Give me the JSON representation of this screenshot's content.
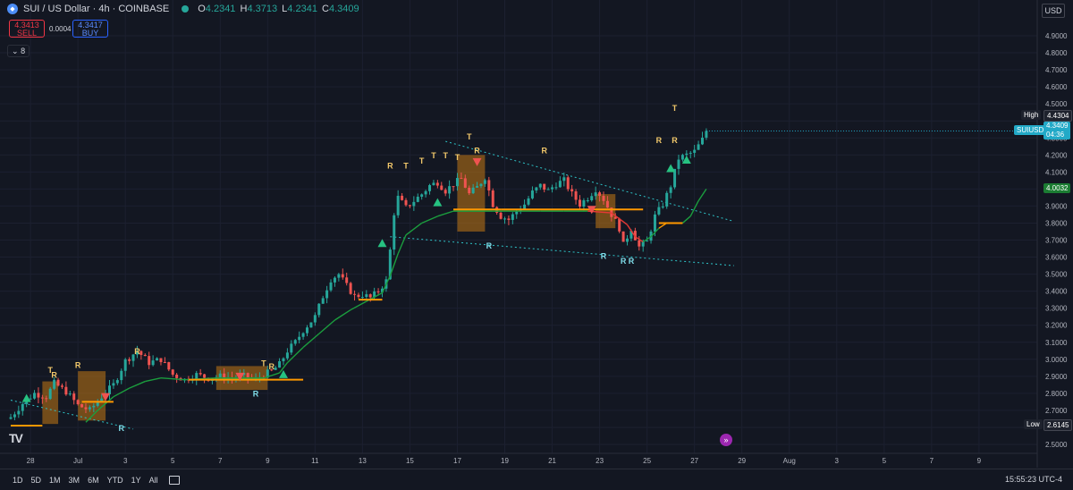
{
  "header": {
    "symbol_icon": "sui-coin-icon",
    "title": "SUI / US Dollar · 4h · COINBASE",
    "ohlc": [
      {
        "k": "O",
        "v": "4.2341"
      },
      {
        "k": "H",
        "v": "4.3713"
      },
      {
        "k": "L",
        "v": "4.2341"
      },
      {
        "k": "C",
        "v": "4.3409"
      }
    ],
    "sell_price": "4.3413",
    "sell_label": "SELL",
    "buy_price": "4.3417",
    "buy_label": "BUY",
    "spread": "0.0004",
    "indicator_count": "8"
  },
  "currency_button": "USD",
  "price_tags": {
    "high_label": "High",
    "high_value": "4.4304",
    "symbol_label": "SUIUSD",
    "last_value": "4.3409",
    "countdown": "04:36",
    "ma_value": "4.0032",
    "low_label": "Low",
    "low_value": "2.6145"
  },
  "toolbar": {
    "timeframes": [
      "1D",
      "5D",
      "1M",
      "3M",
      "6M",
      "YTD",
      "1Y",
      "All"
    ],
    "clock": "15:55:23 UTC-4"
  },
  "colors": {
    "up": "#26a69a",
    "down": "#ef5350",
    "ma": "#1b9e3e",
    "level": "#ff9800",
    "band": "#c27814",
    "trend": "#2ec4c8"
  },
  "chart_data": {
    "type": "candlestick",
    "symbol": "SUIUSD",
    "interval": "4h",
    "ylim": [
      2.5,
      4.9
    ],
    "y_ticks": [
      "4.9000",
      "4.8000",
      "4.7000",
      "4.6000",
      "4.5000",
      "4.4000",
      "4.3000",
      "4.2000",
      "4.1000",
      "4.0000",
      "3.9000",
      "3.8000",
      "3.7000",
      "3.6000",
      "3.5000",
      "3.4000",
      "3.3000",
      "3.2000",
      "3.1000",
      "3.0000",
      "2.9000",
      "2.8000",
      "2.7000",
      "2.6000",
      "2.5000"
    ],
    "y_tick_values": [
      4.9,
      4.8,
      4.7,
      4.6,
      4.5,
      4.4,
      4.3,
      4.2,
      4.1,
      4.0,
      3.9,
      3.8,
      3.7,
      3.6,
      3.5,
      3.4,
      3.3,
      3.2,
      3.1,
      3.0,
      2.9,
      2.8,
      2.7,
      2.6,
      2.5
    ],
    "x_ticks": [
      "28",
      "Jul",
      "3",
      "5",
      "7",
      "9",
      "11",
      "13",
      "15",
      "17",
      "19",
      "21",
      "23",
      "25",
      "27",
      "29",
      "Aug",
      "3",
      "5",
      "7",
      "9"
    ],
    "x_tick_bars": [
      5,
      17,
      29,
      41,
      53,
      65,
      77,
      89,
      101,
      113,
      125,
      137,
      149,
      161,
      173,
      185,
      197,
      209,
      221,
      233,
      245
    ],
    "close_path": [
      [
        0,
        2.66
      ],
      [
        3,
        2.74
      ],
      [
        6,
        2.8
      ],
      [
        9,
        2.78
      ],
      [
        11,
        2.86
      ],
      [
        14,
        2.81
      ],
      [
        17,
        2.73
      ],
      [
        20,
        2.7
      ],
      [
        23,
        2.78
      ],
      [
        26,
        2.85
      ],
      [
        29,
        2.99
      ],
      [
        32,
        3.05
      ],
      [
        35,
        2.98
      ],
      [
        38,
        3.0
      ],
      [
        41,
        2.91
      ],
      [
        44,
        2.88
      ],
      [
        47,
        2.91
      ],
      [
        50,
        2.89
      ],
      [
        53,
        2.9
      ],
      [
        56,
        2.89
      ],
      [
        59,
        2.9
      ],
      [
        62,
        2.88
      ],
      [
        64,
        2.91
      ],
      [
        66,
        2.93
      ],
      [
        68,
        2.97
      ],
      [
        70,
        3.05
      ],
      [
        72,
        3.1
      ],
      [
        74,
        3.17
      ],
      [
        77,
        3.25
      ],
      [
        79,
        3.37
      ],
      [
        81,
        3.47
      ],
      [
        83,
        3.5
      ],
      [
        85,
        3.43
      ],
      [
        87,
        3.37
      ],
      [
        89,
        3.38
      ],
      [
        91,
        3.36
      ],
      [
        93,
        3.4
      ],
      [
        95,
        3.46
      ],
      [
        96,
        3.64
      ],
      [
        97,
        3.86
      ],
      [
        98,
        3.95
      ],
      [
        100,
        3.89
      ],
      [
        102,
        3.93
      ],
      [
        104,
        3.97
      ],
      [
        106,
        4.02
      ],
      [
        108,
        4.04
      ],
      [
        110,
        3.99
      ],
      [
        112,
        4.03
      ],
      [
        114,
        4.06
      ],
      [
        116,
        3.97
      ],
      [
        118,
        4.01
      ],
      [
        120,
        4.07
      ],
      [
        122,
        3.91
      ],
      [
        124,
        3.84
      ],
      [
        126,
        3.82
      ],
      [
        128,
        3.87
      ],
      [
        130,
        3.91
      ],
      [
        132,
        3.98
      ],
      [
        134,
        4.02
      ],
      [
        136,
        3.99
      ],
      [
        138,
        4.03
      ],
      [
        140,
        4.05
      ],
      [
        142,
        3.97
      ],
      [
        144,
        3.91
      ],
      [
        146,
        3.95
      ],
      [
        148,
        4.0
      ],
      [
        150,
        3.94
      ],
      [
        152,
        3.85
      ],
      [
        154,
        3.77
      ],
      [
        155,
        3.67
      ],
      [
        157,
        3.77
      ],
      [
        159,
        3.66
      ],
      [
        161,
        3.69
      ],
      [
        163,
        3.84
      ],
      [
        165,
        3.91
      ],
      [
        167,
        4.02
      ],
      [
        169,
        4.18
      ],
      [
        171,
        4.2
      ],
      [
        173,
        4.22
      ],
      [
        175,
        4.29
      ],
      [
        176,
        4.3409
      ]
    ],
    "moving_average": {
      "name": "",
      "value_last": 4.0032,
      "path": [
        [
          19,
          2.63
        ],
        [
          22,
          2.7
        ],
        [
          26,
          2.78
        ],
        [
          30,
          2.83
        ],
        [
          34,
          2.87
        ],
        [
          38,
          2.89
        ],
        [
          44,
          2.88
        ],
        [
          52,
          2.89
        ],
        [
          58,
          2.89
        ],
        [
          64,
          2.89
        ],
        [
          68,
          2.92
        ],
        [
          70,
          2.98
        ],
        [
          74,
          3.07
        ],
        [
          78,
          3.15
        ],
        [
          82,
          3.23
        ],
        [
          86,
          3.29
        ],
        [
          90,
          3.34
        ],
        [
          94,
          3.39
        ],
        [
          96,
          3.49
        ],
        [
          98,
          3.62
        ],
        [
          100,
          3.73
        ],
        [
          104,
          3.8
        ],
        [
          108,
          3.84
        ],
        [
          112,
          3.87
        ],
        [
          116,
          3.87
        ],
        [
          122,
          3.87
        ],
        [
          128,
          3.87
        ],
        [
          134,
          3.87
        ],
        [
          140,
          3.87
        ],
        [
          146,
          3.87
        ],
        [
          152,
          3.86
        ],
        [
          156,
          3.79
        ],
        [
          158,
          3.72
        ],
        [
          160,
          3.69
        ],
        [
          162,
          3.72
        ],
        [
          164,
          3.77
        ],
        [
          166,
          3.8
        ],
        [
          168,
          3.8
        ],
        [
          170,
          3.8
        ],
        [
          172,
          3.84
        ],
        [
          174,
          3.93
        ],
        [
          176,
          4.0
        ]
      ],
      "segments_red": [
        [
          148,
          160
        ]
      ],
      "segments_orange": [
        [
          164,
          170
        ]
      ]
    },
    "levels": [
      {
        "x0": 0,
        "x1": 8,
        "y": 2.61
      },
      {
        "x0": 18,
        "x1": 26,
        "y": 2.75
      },
      {
        "x0": 45,
        "x1": 74,
        "y": 2.88
      },
      {
        "x0": 88,
        "x1": 94,
        "y": 3.35
      },
      {
        "x0": 112,
        "x1": 124,
        "y": 3.88
      },
      {
        "x0": 124,
        "x1": 160,
        "y": 3.88
      },
      {
        "x0": 164,
        "x1": 170,
        "y": 3.8
      }
    ],
    "bands": [
      {
        "x0": 8,
        "x1": 12,
        "top": 2.87,
        "bottom": 2.62
      },
      {
        "x0": 17,
        "x1": 24,
        "top": 2.93,
        "bottom": 2.64
      },
      {
        "x0": 52,
        "x1": 65,
        "top": 2.96,
        "bottom": 2.82
      },
      {
        "x0": 113,
        "x1": 120,
        "top": 4.2,
        "bottom": 3.75
      },
      {
        "x0": 148,
        "x1": 153,
        "top": 3.97,
        "bottom": 3.77
      }
    ],
    "trendlines": [
      {
        "from": [
          0,
          2.76
        ],
        "to": [
          31,
          2.59
        ]
      },
      {
        "from": [
          96,
          3.72
        ],
        "to": [
          183,
          3.55
        ]
      },
      {
        "from": [
          110,
          4.28
        ],
        "to": [
          183,
          3.81
        ]
      }
    ],
    "markers": [
      {
        "x": 10,
        "y": 2.92,
        "text": "T",
        "color": "#f3c96b"
      },
      {
        "x": 11,
        "y": 2.89,
        "text": "R",
        "color": "#f3c96b"
      },
      {
        "x": 17,
        "y": 2.95,
        "text": "R",
        "color": "#f3c96b"
      },
      {
        "x": 28,
        "y": 2.58,
        "text": "R",
        "color": "#80deea"
      },
      {
        "x": 32,
        "y": 3.03,
        "text": "R",
        "color": "#f3c96b"
      },
      {
        "x": 64,
        "y": 2.96,
        "text": "T",
        "color": "#f3c96b"
      },
      {
        "x": 66,
        "y": 2.94,
        "text": "R",
        "color": "#f3c96b"
      },
      {
        "x": 62,
        "y": 2.78,
        "text": "R",
        "color": "#80deea"
      },
      {
        "x": 96,
        "y": 4.12,
        "text": "R",
        "color": "#f3c96b"
      },
      {
        "x": 100,
        "y": 4.12,
        "text": "T",
        "color": "#f3c96b"
      },
      {
        "x": 104,
        "y": 4.15,
        "text": "T",
        "color": "#f3c96b"
      },
      {
        "x": 107,
        "y": 4.18,
        "text": "T",
        "color": "#f3c96b"
      },
      {
        "x": 110,
        "y": 4.18,
        "text": "T",
        "color": "#f3c96b"
      },
      {
        "x": 113,
        "y": 4.17,
        "text": "T",
        "color": "#f3c96b"
      },
      {
        "x": 116,
        "y": 4.29,
        "text": "T",
        "color": "#f3c96b"
      },
      {
        "x": 118,
        "y": 4.21,
        "text": "R",
        "color": "#f3c96b"
      },
      {
        "x": 121,
        "y": 3.65,
        "text": "R",
        "color": "#80deea"
      },
      {
        "x": 135,
        "y": 4.21,
        "text": "R",
        "color": "#f3c96b"
      },
      {
        "x": 150,
        "y": 3.59,
        "text": "R",
        "color": "#80deea"
      },
      {
        "x": 155,
        "y": 3.56,
        "text": "R",
        "color": "#80deea"
      },
      {
        "x": 157,
        "y": 3.56,
        "text": "R",
        "color": "#80deea"
      },
      {
        "x": 164,
        "y": 4.27,
        "text": "R",
        "color": "#f3c96b"
      },
      {
        "x": 168,
        "y": 4.27,
        "text": "R",
        "color": "#f3c96b"
      },
      {
        "x": 168,
        "y": 4.46,
        "text": "T",
        "color": "#f3c96b"
      }
    ],
    "signals": [
      {
        "x": 4,
        "y": 2.77,
        "dir": "up",
        "color": "#26c281"
      },
      {
        "x": 24,
        "y": 2.78,
        "dir": "down",
        "color": "#ef5350"
      },
      {
        "x": 58,
        "y": 2.9,
        "dir": "down",
        "color": "#ef5350"
      },
      {
        "x": 69,
        "y": 2.91,
        "dir": "up",
        "color": "#26c281"
      },
      {
        "x": 94,
        "y": 3.68,
        "dir": "up",
        "color": "#26c281"
      },
      {
        "x": 108,
        "y": 3.92,
        "dir": "up",
        "color": "#26c281"
      },
      {
        "x": 118,
        "y": 4.16,
        "dir": "down",
        "color": "#ef5350"
      },
      {
        "x": 147,
        "y": 3.88,
        "dir": "down",
        "color": "#ef5350"
      },
      {
        "x": 167,
        "y": 4.12,
        "dir": "up",
        "color": "#26c281"
      },
      {
        "x": 171,
        "y": 4.17,
        "dir": "up",
        "color": "#26c281"
      }
    ]
  }
}
